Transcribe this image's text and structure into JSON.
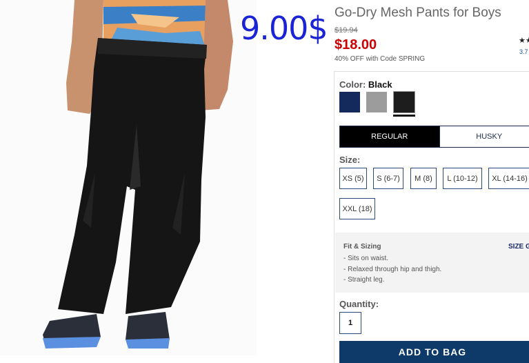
{
  "overlay": {
    "price_note": "9.00$"
  },
  "product": {
    "title": "Go-Dry Mesh Pants for Boys",
    "original_price": "$19.94",
    "sale_price": "$18.00",
    "promo": "40% OFF with Code SPRING",
    "stars": "★★",
    "rating": "3.7"
  },
  "color": {
    "label": "Color:",
    "selected": "Black",
    "swatches": [
      {
        "name": "Navy",
        "hex": "#142a5c"
      },
      {
        "name": "Grey",
        "hex": "#9c9c9c"
      },
      {
        "name": "Black",
        "hex": "#1d1d1d"
      }
    ]
  },
  "fit": {
    "tabs": [
      {
        "label": "REGULAR",
        "active": true
      },
      {
        "label": "HUSKY",
        "active": false
      }
    ]
  },
  "size": {
    "label": "Size:",
    "options": [
      "XS (5)",
      "S (6-7)",
      "M (8)",
      "L (10-12)",
      "XL (14-16)",
      "XXL (18)"
    ]
  },
  "fit_sizing": {
    "title": "Fit & Sizing",
    "guide_link": "SIZE G",
    "items": [
      "- Sits on waist.",
      "- Relaxed through hip and thigh.",
      "- Straight leg."
    ]
  },
  "quantity": {
    "label": "Quantity:",
    "value": "1"
  },
  "cart": {
    "add_label": "ADD TO BAG"
  },
  "colors": {
    "sale_red": "#cc0000",
    "overlay_blue": "#1a24d6",
    "brand_navy": "#0e3a6a"
  }
}
